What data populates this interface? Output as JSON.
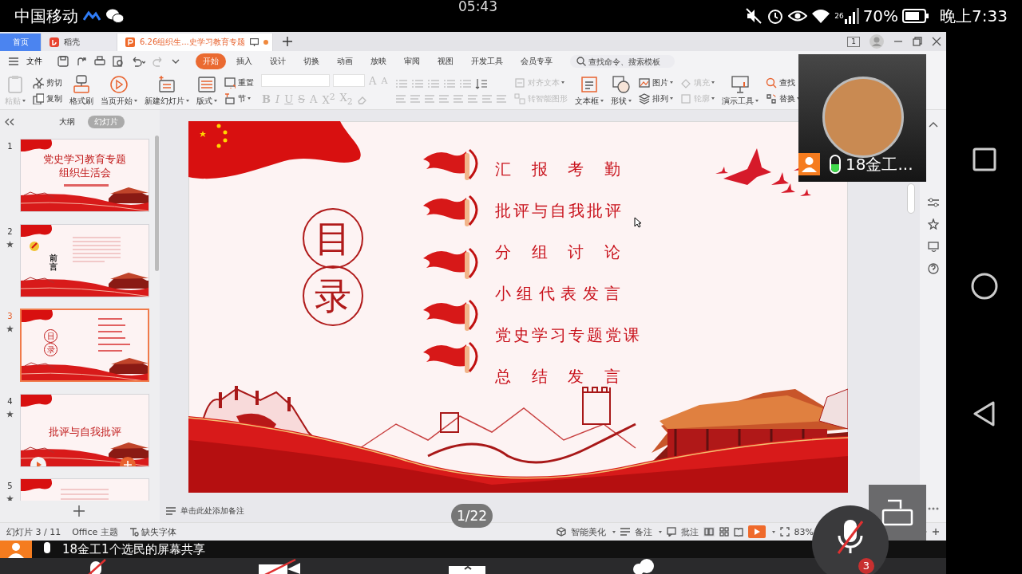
{
  "status_bar": {
    "carrier": "中国移动",
    "clock": "05:43",
    "network": "26",
    "battery": "70%",
    "time": "晚上7:33"
  },
  "app": {
    "tabs": [
      {
        "label": "首页",
        "kind": "home",
        "selected": false
      },
      {
        "label": "稻壳",
        "kind": "docer",
        "selected": false
      },
      {
        "label": "6.26组织生...史学习教育专题",
        "kind": "doc",
        "selected": true
      }
    ],
    "window_count": "1",
    "file_menu": "文件",
    "ribbon_tabs": [
      {
        "label": "开始",
        "selected": true
      },
      {
        "label": "插入",
        "selected": false
      },
      {
        "label": "设计",
        "selected": false
      },
      {
        "label": "切换",
        "selected": false
      },
      {
        "label": "动画",
        "selected": false
      },
      {
        "label": "放映",
        "selected": false
      },
      {
        "label": "审阅",
        "selected": false
      },
      {
        "label": "视图",
        "selected": false
      },
      {
        "label": "开发工具",
        "selected": false
      },
      {
        "label": "会员专享",
        "selected": false
      }
    ],
    "search": {
      "placeholder": "查找命令、搜索模板"
    },
    "toolbar": [
      {
        "kind": "large",
        "label": "粘贴",
        "disabled": true,
        "dropdown": true
      },
      {
        "kind": "small",
        "label": "剪切",
        "disabled": false,
        "dropdown": false
      },
      {
        "kind": "small",
        "label": "复制",
        "disabled": false,
        "dropdown": false
      },
      {
        "kind": "large",
        "label": "格式刷",
        "disabled": false,
        "dropdown": false
      },
      {
        "kind": "large",
        "label": "当页开始",
        "disabled": false,
        "dropdown": true
      },
      {
        "kind": "large",
        "label": "新建幻灯片",
        "disabled": false,
        "dropdown": true
      },
      {
        "kind": "large",
        "label": "版式",
        "disabled": false,
        "dropdown": true
      },
      {
        "kind": "small",
        "label": "重置",
        "disabled": false,
        "dropdown": false
      },
      {
        "kind": "small",
        "label": "节",
        "disabled": false,
        "dropdown": true
      },
      {
        "kind": "font",
        "disabled": true,
        "dropdown": false
      },
      {
        "kind": "paragraph",
        "disabled": false,
        "dropdown": false
      },
      {
        "kind": "small",
        "label": "对齐文本",
        "disabled": true,
        "dropdown": true
      },
      {
        "kind": "small",
        "label": "转智能图形",
        "disabled": true,
        "dropdown": false
      },
      {
        "kind": "large",
        "label": "文本框",
        "disabled": false,
        "dropdown": true
      },
      {
        "kind": "large",
        "label": "形状",
        "disabled": false,
        "dropdown": true
      },
      {
        "kind": "small",
        "label": "图片",
        "disabled": false,
        "dropdown": true
      },
      {
        "kind": "small",
        "label": "排列",
        "disabled": false,
        "dropdown": true
      },
      {
        "kind": "small",
        "label": "填充",
        "disabled": true,
        "dropdown": true
      },
      {
        "kind": "small",
        "label": "轮廓",
        "disabled": true,
        "dropdown": true
      },
      {
        "kind": "large",
        "label": "演示工具",
        "disabled": false,
        "dropdown": true
      },
      {
        "kind": "small",
        "label": "查找",
        "disabled": false,
        "dropdown": false
      },
      {
        "kind": "small",
        "label": "替换",
        "disabled": false,
        "dropdown": true
      }
    ],
    "format_buttons": [
      "B",
      "I",
      "U",
      "S",
      "A",
      "X$^{2}$",
      "X$_{2}$"
    ],
    "size_buttons": [
      "A",
      "A"
    ],
    "panel_tabs": [
      {
        "label": "大纲",
        "selected": false
      },
      {
        "label": "幻灯片",
        "selected": true
      }
    ],
    "slides": [
      {
        "number": "1",
        "kind": "cover",
        "selected": false,
        "starred": false,
        "hovered": false,
        "texts": [
          "党史学习教育专题",
          "组织生活会"
        ]
      },
      {
        "number": "2",
        "kind": "preface",
        "selected": false,
        "starred": true,
        "hovered": false,
        "texts": [
          "前言"
        ]
      },
      {
        "number": "3",
        "kind": "contents",
        "selected": true,
        "starred": true,
        "hovered": false,
        "texts": [
          "目",
          "录"
        ]
      },
      {
        "number": "4",
        "kind": "section",
        "selected": false,
        "starred": true,
        "hovered": true,
        "texts": [
          "批评与自我批评"
        ]
      },
      {
        "number": "5",
        "kind": "text",
        "selected": false,
        "starred": true,
        "hovered": false
      }
    ],
    "slide": {
      "heading": [
        "目",
        "录"
      ],
      "items": [
        "汇报考勤",
        "批评与自我批评",
        "分组讨论",
        "小组代表发言",
        "党史学习专题党课",
        "总结发言"
      ]
    },
    "notes": {
      "placeholder": "单击此处添加备注"
    },
    "app_status": {
      "slide_count": "幻灯片 3 / 11",
      "theme": "Office 主题",
      "missing_font": "缺失字体",
      "beautify": "智能美化",
      "notes": "备注",
      "comments": "批注",
      "zoom": "83%"
    }
  },
  "page_badge": "1/22",
  "video": {
    "name": "18金工...",
    "level": 0.5
  },
  "share_banner": "18金工1个选民的屏幕共享",
  "mic_badge": "3"
}
